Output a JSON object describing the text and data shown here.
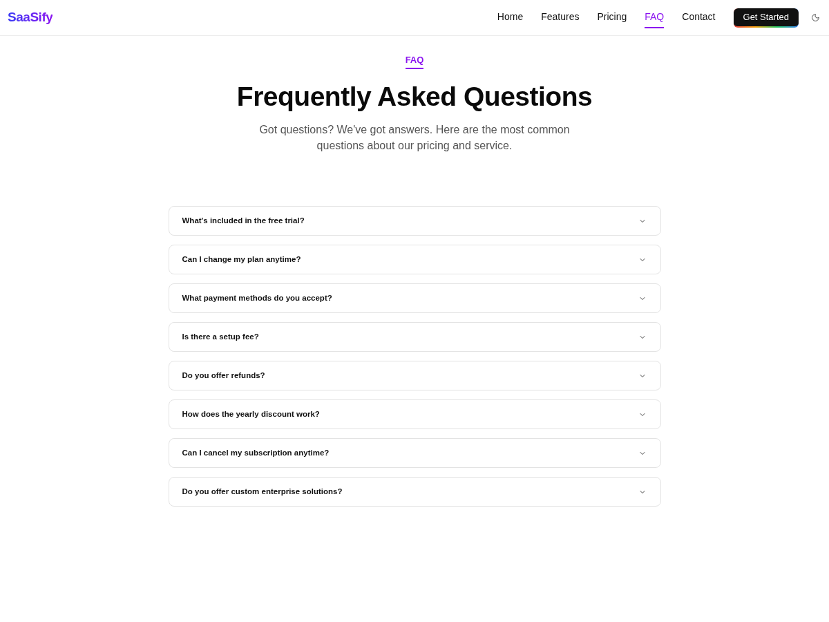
{
  "header": {
    "logo": "SaaSify",
    "nav": [
      {
        "label": "Home",
        "selected": false
      },
      {
        "label": "Features",
        "selected": false
      },
      {
        "label": "Pricing",
        "selected": false
      },
      {
        "label": "FAQ",
        "selected": true
      },
      {
        "label": "Contact",
        "selected": false
      }
    ],
    "cta": "Get Started"
  },
  "hero": {
    "eyebrow": "FAQ",
    "title": "Frequently Asked Questions",
    "subtitle": "Got questions? We've got answers. Here are the most common questions about our pricing and service."
  },
  "faq": [
    {
      "question": "What's included in the free trial?",
      "expanded": false
    },
    {
      "question": "Can I change my plan anytime?",
      "expanded": false
    },
    {
      "question": "What payment methods do you accept?",
      "expanded": false
    },
    {
      "question": "Is there a setup fee?",
      "expanded": false
    },
    {
      "question": "Do you offer refunds?",
      "expanded": false
    },
    {
      "question": "How does the yearly discount work?",
      "expanded": false
    },
    {
      "question": "Can I cancel my subscription anytime?",
      "expanded": false
    },
    {
      "question": "Do you offer custom enterprise solutions?",
      "expanded": false
    }
  ]
}
